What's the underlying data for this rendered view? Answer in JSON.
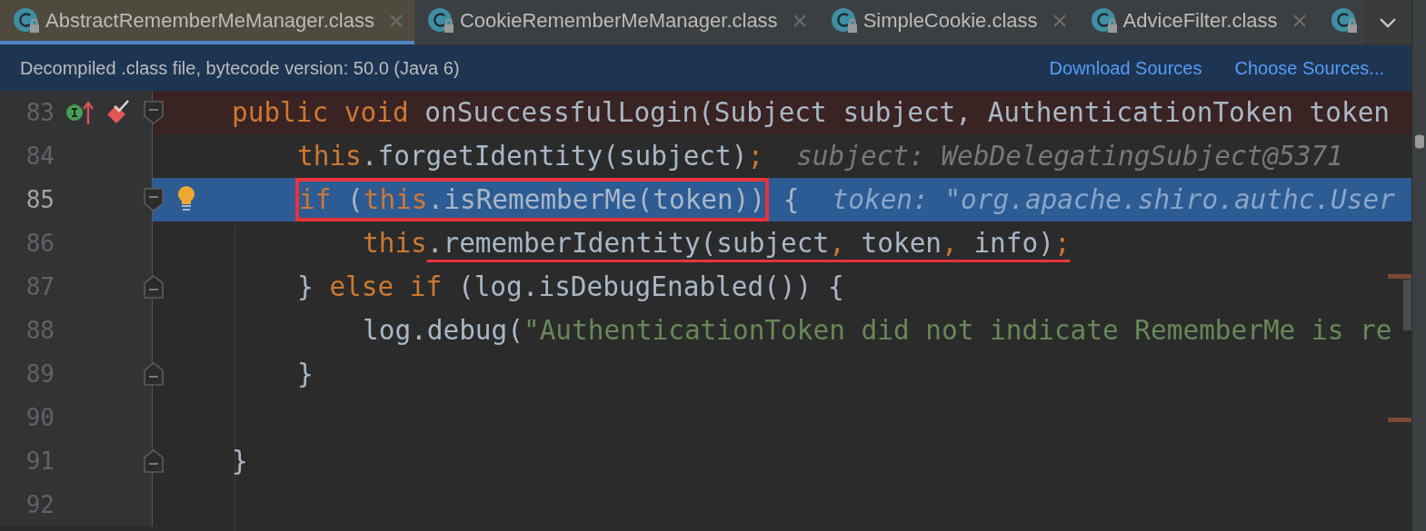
{
  "tabs": [
    {
      "label": "AbstractRememberMeManager.class",
      "selected": true
    },
    {
      "label": "CookieRememberMeManager.class",
      "selected": false
    },
    {
      "label": "SimpleCookie.class",
      "selected": false
    },
    {
      "label": "AdviceFilter.class",
      "selected": false
    },
    {
      "selected": false
    }
  ],
  "info_bar": {
    "message": "Decompiled .class file, bytecode version: 50.0 (Java 6)",
    "links": [
      "Download Sources",
      "Choose Sources..."
    ]
  },
  "editor": {
    "lines": [
      {
        "number": "83",
        "kind": "signature",
        "breakpoint_line": true,
        "execution_line": false,
        "current": false,
        "markers": [
          {
            "kind": "implements"
          },
          {
            "kind": "breakpoint"
          }
        ],
        "fold": {
          "kind": "start"
        },
        "segments": [
          {
            "kind": "plain",
            "tokens": [
              {
                "kind": "keyword",
                "text": "public void"
              },
              {
                "kind": "plain",
                "text": " onSuccessfulLogin(Subject subject, AuthenticationToken token"
              }
            ]
          }
        ]
      },
      {
        "number": "84",
        "kind": "statement",
        "breakpoint_line": false,
        "execution_line": false,
        "current": false,
        "segments": [
          {
            "kind": "plain",
            "tokens": [
              {
                "kind": "keyword",
                "text": "this"
              },
              {
                "kind": "plain",
                "text": ".forgetIdentity(subject)"
              },
              {
                "kind": "keyword",
                "text": ";"
              }
            ]
          }
        ],
        "hint": "subject: WebDelegatingSubject@5371"
      },
      {
        "number": "85",
        "kind": "statement",
        "breakpoint_line": false,
        "execution_line": true,
        "current": true,
        "markers": [
          {
            "kind": "bulb"
          }
        ],
        "fold": {
          "kind": "start"
        },
        "segments": [
          {
            "kind": "boxed",
            "tokens": [
              {
                "kind": "keyword",
                "text": "if"
              },
              {
                "kind": "plain",
                "text": " ("
              },
              {
                "kind": "keyword",
                "text": "this"
              },
              {
                "kind": "plain",
                "text": ".isRememberMe(token))"
              }
            ]
          },
          {
            "kind": "plain",
            "tokens": [
              {
                "kind": "plain",
                "text": " {"
              }
            ]
          }
        ],
        "hint": "token: \"org.apache.shiro.authc.User"
      },
      {
        "number": "86",
        "kind": "nested",
        "breakpoint_line": false,
        "execution_line": false,
        "current": false,
        "segments": [
          {
            "kind": "plain",
            "tokens": [
              {
                "kind": "keyword",
                "text": "this"
              }
            ]
          },
          {
            "kind": "underlined",
            "tokens": [
              {
                "kind": "plain",
                "text": ".rememberIdentity(subject"
              },
              {
                "kind": "keyword",
                "text": ","
              },
              {
                "kind": "plain",
                "text": " token"
              },
              {
                "kind": "keyword",
                "text": ","
              },
              {
                "kind": "plain",
                "text": " info)"
              },
              {
                "kind": "keyword",
                "text": ";"
              }
            ]
          }
        ]
      },
      {
        "number": "87",
        "kind": "statement",
        "breakpoint_line": false,
        "execution_line": false,
        "current": false,
        "fold": {
          "kind": "end"
        },
        "segments": [
          {
            "kind": "plain",
            "tokens": [
              {
                "kind": "plain",
                "text": "} "
              },
              {
                "kind": "keyword",
                "text": "else if"
              },
              {
                "kind": "plain",
                "text": " (log.isDebugEnabled()) {"
              }
            ]
          }
        ]
      },
      {
        "number": "88",
        "kind": "nested",
        "breakpoint_line": false,
        "execution_line": false,
        "current": false,
        "segments": [
          {
            "kind": "plain",
            "tokens": [
              {
                "kind": "plain",
                "text": "log.debug("
              },
              {
                "kind": "string",
                "text": "\"AuthenticationToken did not indicate RememberMe is re"
              }
            ]
          }
        ]
      },
      {
        "number": "89",
        "kind": "statement",
        "breakpoint_line": false,
        "execution_line": false,
        "current": false,
        "fold": {
          "kind": "end"
        },
        "segments": [
          {
            "kind": "plain",
            "tokens": [
              {
                "kind": "plain",
                "text": "}"
              }
            ]
          }
        ]
      },
      {
        "number": "90",
        "kind": "signature",
        "breakpoint_line": false,
        "execution_line": false,
        "current": false
      },
      {
        "number": "91",
        "kind": "signature",
        "breakpoint_line": false,
        "execution_line": false,
        "current": false,
        "fold": {
          "kind": "end"
        },
        "segments": [
          {
            "kind": "plain",
            "tokens": [
              {
                "kind": "plain",
                "text": "}"
              }
            ]
          }
        ]
      },
      {
        "number": "92",
        "kind": "signature",
        "breakpoint_line": false,
        "execution_line": false,
        "current": false
      }
    ]
  }
}
